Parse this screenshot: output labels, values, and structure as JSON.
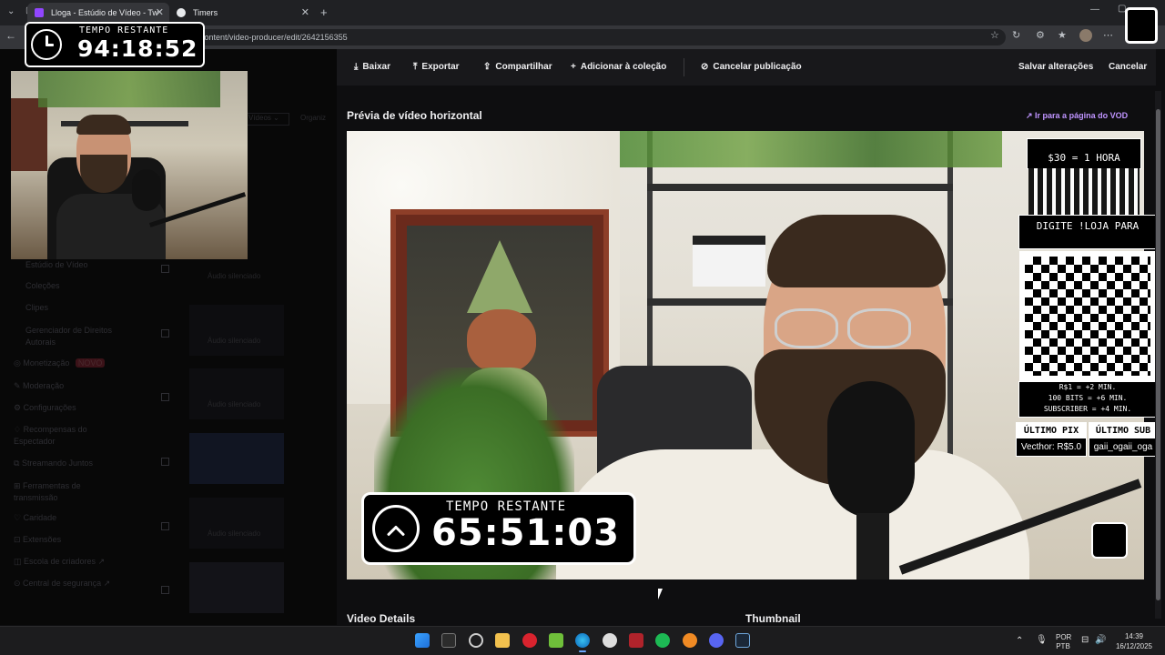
{
  "browser": {
    "tabs": [
      {
        "title": "Lloga - Estúdio de Vídeo - Tw"
      },
      {
        "title": "Timers"
      }
    ],
    "url": "content/video-producer/edit/2642156355"
  },
  "timer_small": {
    "label": "TEMPO RESTANTE",
    "value": "94:18:52"
  },
  "sidebar": {
    "items": [
      {
        "label": "Estúdio de Vídeo"
      },
      {
        "label": "Coleções"
      },
      {
        "label": "Clipes"
      },
      {
        "label": "Gerenciador de Direitos Autorais"
      },
      {
        "label": "Monetização",
        "badge": "NOVO"
      },
      {
        "label": "Moderação"
      },
      {
        "label": "Configurações"
      },
      {
        "label": "Recompensas do Espectador"
      },
      {
        "label": "Streamando Juntos"
      },
      {
        "label": "Ferramentas de transmissão"
      },
      {
        "label": "Caridade"
      },
      {
        "label": "Extensões"
      },
      {
        "label": "Escola de criadores"
      },
      {
        "label": "Central de segurança"
      }
    ],
    "filter_label": "Vídeos",
    "sort_label": "Organiz"
  },
  "video_list": {
    "silenced_label": "Áudio silenciado"
  },
  "actions": {
    "download": "Baixar",
    "export": "Exportar",
    "share": "Compartilhar",
    "add_collection": "Adicionar à coleção",
    "unpublish": "Cancelar publicação",
    "save": "Salvar alterações",
    "cancel": "Cancelar"
  },
  "preview": {
    "title": "Prévia de vídeo horizontal",
    "vod_link": "Ir para a página do VOD"
  },
  "overlay": {
    "price": "$30 = 1 HORA",
    "store_text": "DIGITE !LOJA PARA",
    "rates": [
      "R$1 = +2 MIN.",
      "100 BITS = +6 MIN.",
      "SUBSCRIBER = +4 MIN."
    ],
    "last_pix_label": "ÚLTIMO PIX",
    "last_pix_value": "Vecthor: R$5.0",
    "last_sub_label": "ÚLTIMO SUB",
    "last_sub_value": "gaii_ogaii_oga",
    "timer": {
      "label": "TEMPO RESTANTE",
      "value": "65:51:03"
    }
  },
  "sections": {
    "details": "Video Details",
    "thumbnail": "Thumbnail"
  },
  "system_tray": {
    "lang1": "POR",
    "lang2": "PTB",
    "time": "14:39",
    "date": "16/12/2025"
  },
  "colors": {
    "accent": "#bf94ff",
    "background": "#0e0e10",
    "panel": "#18181b"
  }
}
